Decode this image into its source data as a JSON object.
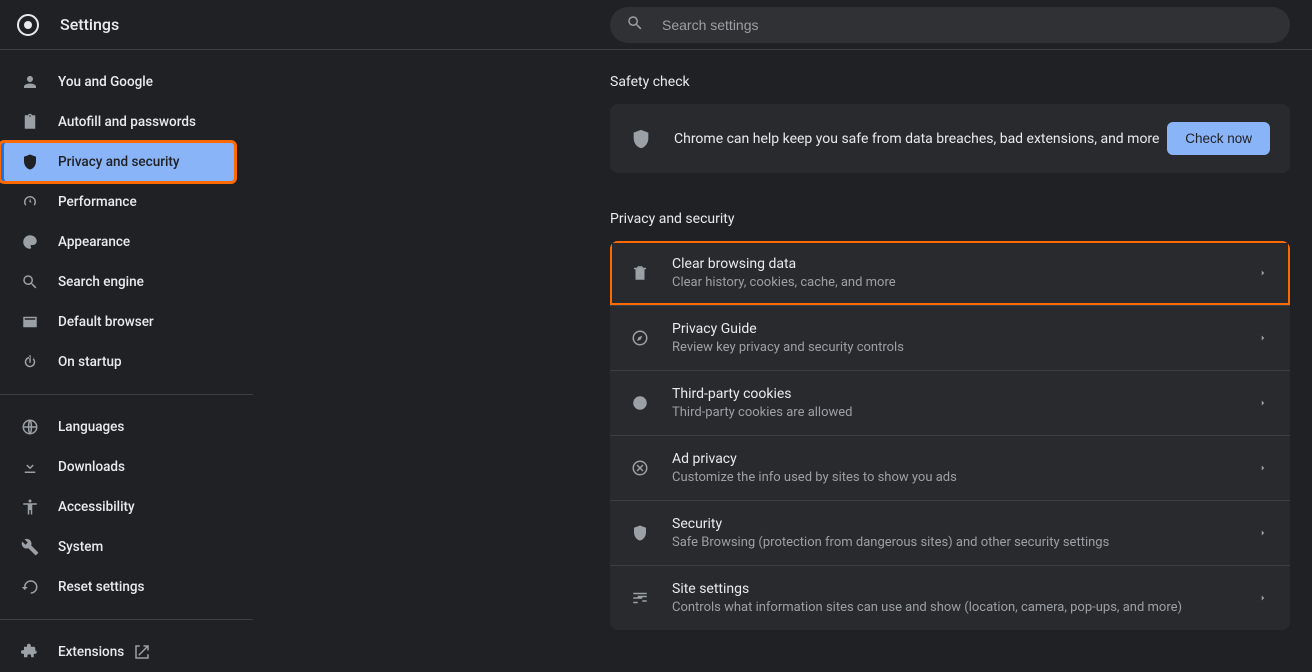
{
  "app": {
    "title": "Settings"
  },
  "search": {
    "placeholder": "Search settings"
  },
  "sidebar": {
    "groups": [
      [
        {
          "id": "you-google",
          "label": "You and Google"
        },
        {
          "id": "autofill",
          "label": "Autofill and passwords"
        },
        {
          "id": "privacy",
          "label": "Privacy and security",
          "selected": true,
          "highlight": true
        },
        {
          "id": "performance",
          "label": "Performance"
        },
        {
          "id": "appearance",
          "label": "Appearance"
        },
        {
          "id": "search-engine",
          "label": "Search engine"
        },
        {
          "id": "default-browser",
          "label": "Default browser"
        },
        {
          "id": "startup",
          "label": "On startup"
        }
      ],
      [
        {
          "id": "languages",
          "label": "Languages"
        },
        {
          "id": "downloads",
          "label": "Downloads"
        },
        {
          "id": "accessibility",
          "label": "Accessibility"
        },
        {
          "id": "system",
          "label": "System"
        },
        {
          "id": "reset",
          "label": "Reset settings"
        }
      ],
      [
        {
          "id": "extensions",
          "label": "Extensions",
          "external": true
        }
      ]
    ]
  },
  "safety": {
    "section_title": "Safety check",
    "message": "Chrome can help keep you safe from data breaches, bad extensions, and more",
    "button": "Check now"
  },
  "privacy": {
    "section_title": "Privacy and security",
    "rows": [
      {
        "id": "clear",
        "title": "Clear browsing data",
        "sub": "Clear history, cookies, cache, and more",
        "highlight": true
      },
      {
        "id": "guide",
        "title": "Privacy Guide",
        "sub": "Review key privacy and security controls"
      },
      {
        "id": "cookies",
        "title": "Third-party cookies",
        "sub": "Third-party cookies are allowed"
      },
      {
        "id": "adprivacy",
        "title": "Ad privacy",
        "sub": "Customize the info used by sites to show you ads"
      },
      {
        "id": "security",
        "title": "Security",
        "sub": "Safe Browsing (protection from dangerous sites) and other security settings"
      },
      {
        "id": "sitesettings",
        "title": "Site settings",
        "sub": "Controls what information sites can use and show (location, camera, pop-ups, and more)"
      }
    ]
  }
}
